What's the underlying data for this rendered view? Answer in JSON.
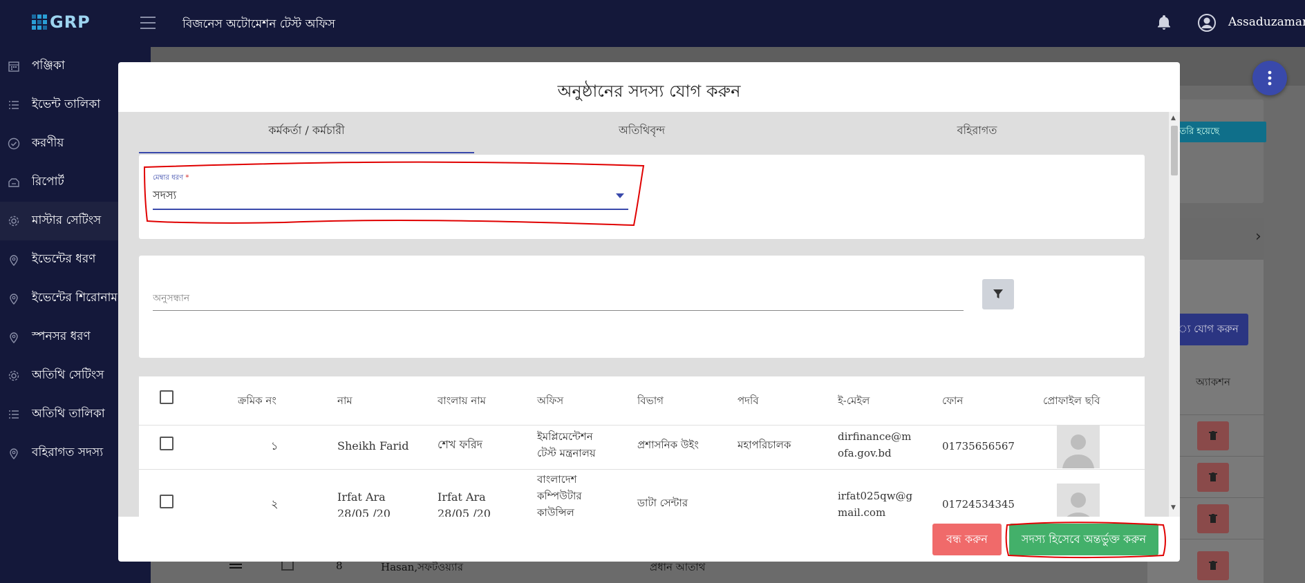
{
  "header": {
    "logo": "GRP",
    "title": "বিজনেস অটোমেশন টেস্ট অফিস",
    "username": "Assaduzaman"
  },
  "sidebar": {
    "items": [
      {
        "label": "পঞ্জিকা",
        "icon": "calendar-icon"
      },
      {
        "label": "ইভেন্ট তালিকা",
        "icon": "list-icon"
      },
      {
        "label": "করণীয়",
        "icon": "check-circle-icon"
      },
      {
        "label": "রিপোর্ট",
        "icon": "report-icon"
      },
      {
        "label": "মাস্টার সেটিংস",
        "icon": "gear-icon"
      },
      {
        "label": "ইভেন্টের ধরণ",
        "icon": "location-pin-icon"
      },
      {
        "label": "ইভেন্টের শিরোনাম",
        "icon": "location-pin-icon"
      },
      {
        "label": "স্পনসর ধরণ",
        "icon": "location-pin-icon"
      },
      {
        "label": "অতিথি সেটিংস",
        "icon": "gear-icon"
      },
      {
        "label": "অতিথি তালিকা",
        "icon": "list-icon"
      },
      {
        "label": "বহিরাগত সদস্য",
        "icon": "location-pin-icon"
      }
    ]
  },
  "background": {
    "chip_text": "ট তৈরি হয়েছে",
    "add_button": "্য যোগ করুন",
    "action_header": "অ্যাকশন",
    "row_text": "Hasan,সফটওয়্যার",
    "row_num": "8",
    "row_designation": "প্রধান আতাথ"
  },
  "modal": {
    "title": "অনুষ্ঠানের সদস্য যোগ করুন",
    "tabs": [
      "কর্মকর্তা / কর্মচারী",
      "অতিথিবৃন্দ",
      "বহিরাগত"
    ],
    "active_tab": 0,
    "member_type": {
      "label": "মেম্বার ধরণ",
      "required_mark": "*",
      "value": "সদস্য"
    },
    "search": {
      "placeholder": "অনুসন্ধান"
    },
    "table": {
      "headers": [
        "ক্রমিক নং",
        "নাম",
        "বাংলায় নাম",
        "অফিস",
        "বিভাগ",
        "পদবি",
        "ই-মেইল",
        "ফোন",
        "প্রোফাইল ছবি"
      ],
      "rows": [
        {
          "serial": "১",
          "name": "Sheikh Farid",
          "name_bn": "শেখ ফরিদ",
          "office": "ইমপ্লিমেন্টেশন টেস্ট মন্ত্রনালয়",
          "department": "প্রশাসনিক উইং",
          "designation": "মহাপরিচালক",
          "email": "dirfinance@mofa.gov.bd",
          "phone": "01735656567"
        },
        {
          "serial": "২",
          "name": "Irfat Ara 28/05 /20",
          "name_bn": "Irfat Ara 28/05 /20",
          "office": "বাংলাদেশ কম্পিউটার কাউন্সিল",
          "department": "ডাটা সেন্টার",
          "designation": "",
          "email": "irfat025qw@gmail.com",
          "phone": "01724534345"
        }
      ]
    },
    "buttons": {
      "close": "বন্ধ করুন",
      "add_member": "সদস্য হিসেবে অন্তর্ভুক্ত করুন"
    }
  },
  "colors": {
    "nav_bg": "#14183a",
    "accent": "#3949ab",
    "close_button": "#f06a6a",
    "add_button": "#43b06a",
    "annotation": "#e00000"
  }
}
